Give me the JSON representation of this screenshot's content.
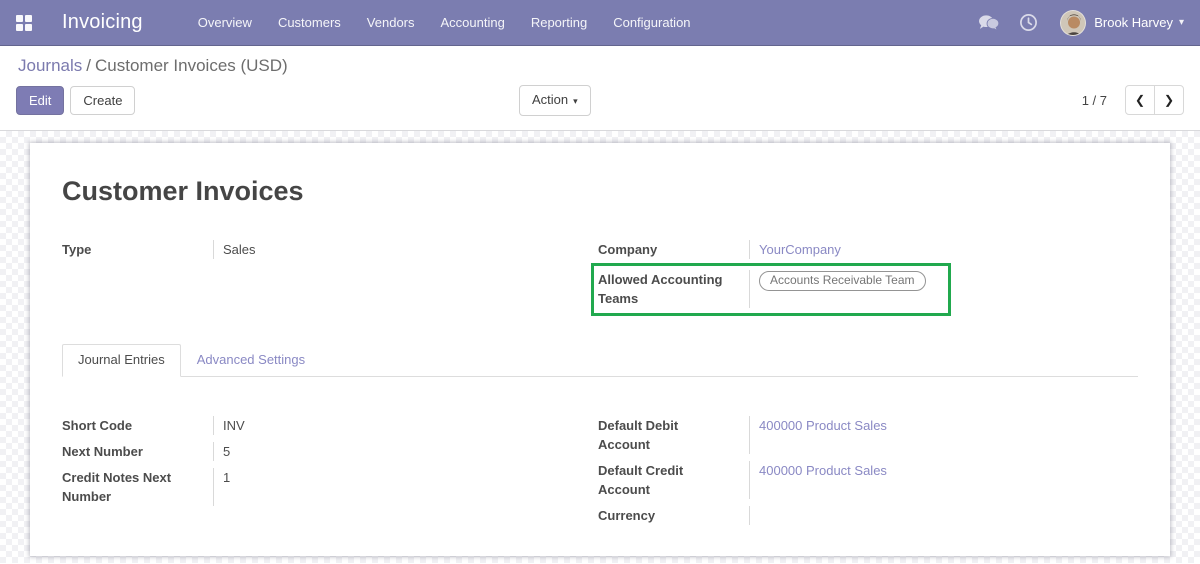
{
  "navbar": {
    "brand": "Invoicing",
    "menu_items": [
      "Overview",
      "Customers",
      "Vendors",
      "Accounting",
      "Reporting",
      "Configuration"
    ],
    "user": {
      "name": "Brook Harvey",
      "caret": "▾"
    },
    "background_color": "#7b7db0"
  },
  "breadcrumb": {
    "parent": "Journals",
    "separator": "/",
    "current": "Customer Invoices (USD)"
  },
  "toolbar": {
    "edit_label": "Edit",
    "create_label": "Create",
    "action_label": "Action",
    "action_caret": "▾"
  },
  "pager": {
    "counter": "1 / 7",
    "prev_icon": "❮",
    "next_icon": "❯"
  },
  "form": {
    "title": "Customer Invoices",
    "fields": {
      "type": {
        "label": "Type",
        "value": "Sales"
      },
      "company": {
        "label": "Company",
        "value": "YourCompany"
      },
      "allowed_teams": {
        "label": "Allowed Accounting Teams",
        "tag": "Accounts Receivable Team"
      },
      "short_code": {
        "label": "Short Code",
        "value": "INV"
      },
      "next_number": {
        "label": "Next Number",
        "value": "5"
      },
      "credit_notes_next_number": {
        "label": "Credit Notes Next Number",
        "value": "1"
      },
      "default_debit_account": {
        "label": "Default Debit Account",
        "value": "400000 Product Sales"
      },
      "default_credit_account": {
        "label": "Default Credit Account",
        "value": "400000 Product Sales"
      },
      "currency": {
        "label": "Currency",
        "value": ""
      }
    },
    "tabs": [
      {
        "label": "Journal Entries"
      },
      {
        "label": "Advanced Settings"
      }
    ],
    "highlight_color": "#21a94e",
    "link_color": "#8a89c4"
  }
}
